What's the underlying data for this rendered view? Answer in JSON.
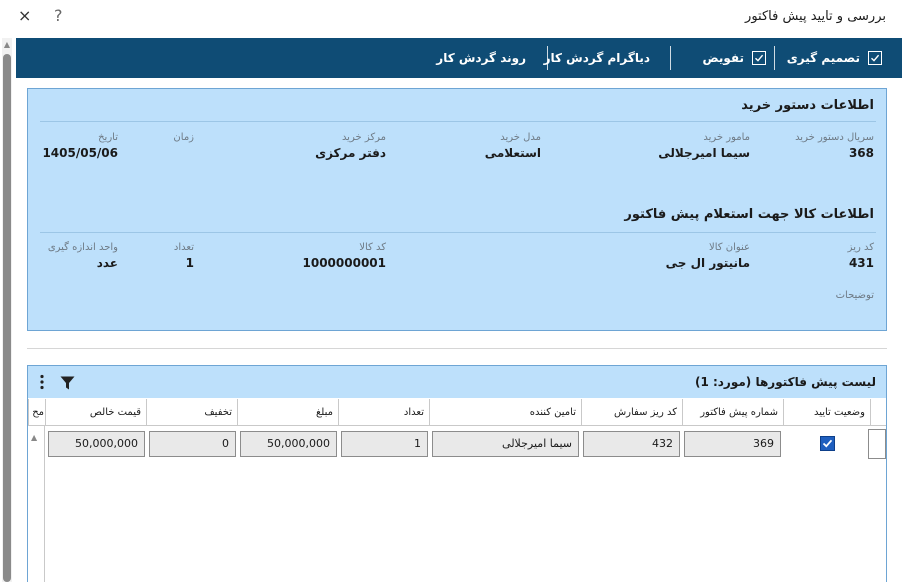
{
  "window": {
    "title": "بررسی و تایید پیش فاکتور",
    "close_label": "×",
    "help_label": "?"
  },
  "toolbar": {
    "items": [
      {
        "label": "تصمیم گیری",
        "icon": "checkbox-icon"
      },
      {
        "label": "تفویض",
        "icon": "checkbox-icon"
      },
      {
        "label": "دیاگرام گردش کار"
      },
      {
        "label": "روند گردش کار"
      }
    ]
  },
  "order_info": {
    "title": "اطلاعات دستور خرید",
    "fields": [
      {
        "label": "سریال دستور خرید",
        "value": "368"
      },
      {
        "label": "مامور خرید",
        "value": "سیما امیرجلالی"
      },
      {
        "label": "مدل خرید",
        "value": "استعلامی"
      },
      {
        "label": "مرکز خرید",
        "value": "دفتر مرکزی"
      },
      {
        "label": "زمان",
        "value": ""
      },
      {
        "label": "تاریخ",
        "value": "1405/05/06"
      }
    ]
  },
  "item_info": {
    "title": "اطلاعات کالا جهت استعلام پیش فاکتور",
    "fields": [
      {
        "label": "کد ریز",
        "value": "431"
      },
      {
        "label": "عنوان کالا",
        "value": "مانیتور ال جی"
      },
      {
        "label": "کد کالا",
        "value": "1000000001"
      },
      {
        "label": "تعداد",
        "value": "1"
      },
      {
        "label": "واحد اندازه گیری",
        "value": "عدد"
      }
    ],
    "notes_label": "توضیحات"
  },
  "invoice_list": {
    "title": "لیست پیش فاکتورها (مورد: 1)",
    "columns": [
      "وضعیت تایید",
      "شماره پیش فاکتور",
      "کد ریز سفارش",
      "تامین کننده",
      "تعداد",
      "مبلغ",
      "تخفیف",
      "قیمت خالص",
      "مح"
    ],
    "rows": [
      {
        "approved": true,
        "invoice_no": "369",
        "order_item_code": "432",
        "supplier": "سیما امیرجلالی",
        "quantity": "1",
        "amount": "50,000,000",
        "discount": "0",
        "net_price": "50,000,000"
      }
    ]
  },
  "colors": {
    "toolbar_bg": "#0f4c75",
    "panel_bg": "#bde0fb",
    "panel_border": "#6ea5d4",
    "checkbox_checked": "#1f5fbf"
  }
}
